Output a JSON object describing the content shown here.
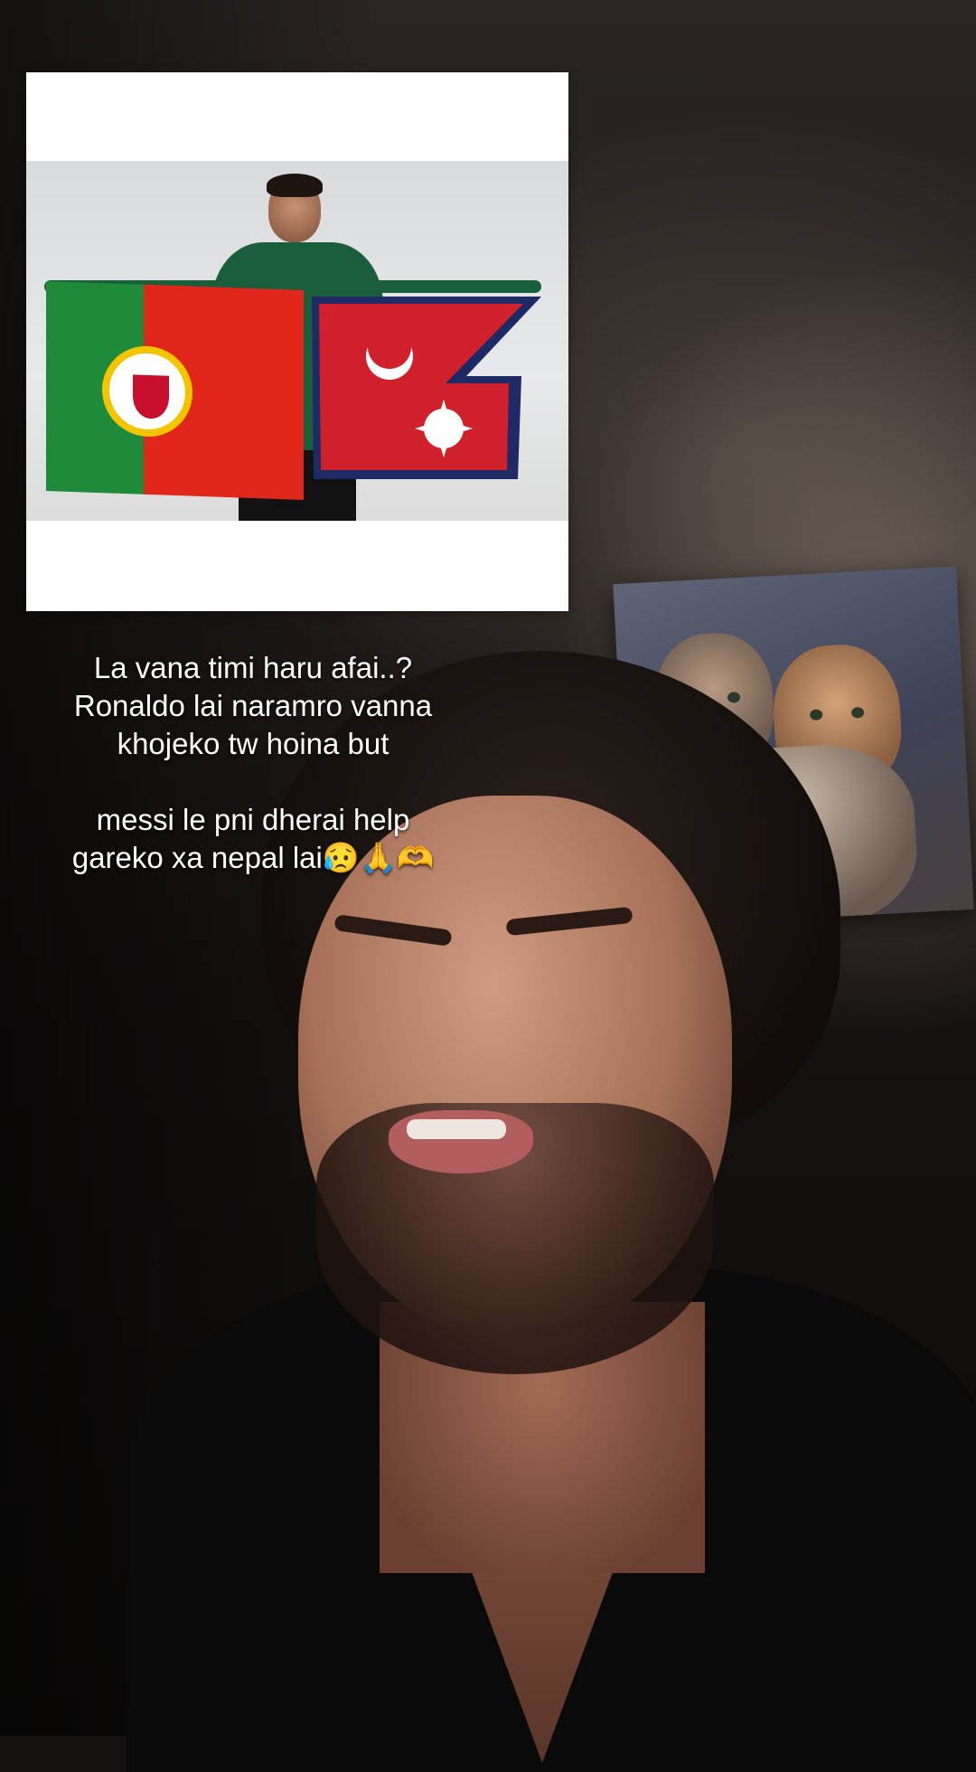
{
  "caption": {
    "line1": "La vana timi haru afai..?",
    "line2": "Ronaldo lai naramro vanna",
    "line3": "khojeko tw hoina but",
    "line4": "messi le pni dherai help",
    "line5": "gareko xa nepal lai😥🙏🫶"
  },
  "colors": {
    "portugal_green": "#1f8a3a",
    "portugal_red": "#e1261c",
    "nepal_red": "#d0202b",
    "nepal_blue": "#1d2a66",
    "jersey_green": "#1b5e3b"
  }
}
